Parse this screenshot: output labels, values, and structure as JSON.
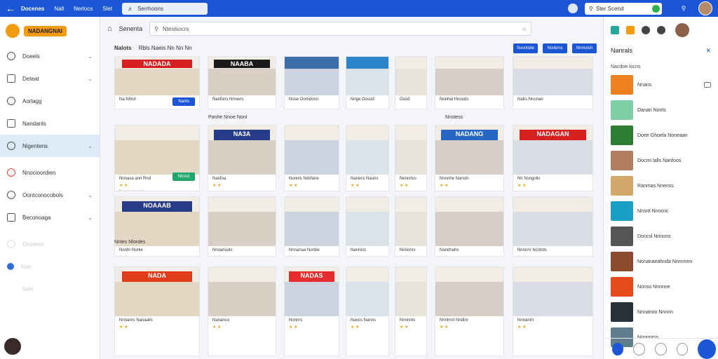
{
  "topbar": {
    "tabs": [
      "Docenes",
      "Nall",
      "Nerlocs",
      "Slet"
    ],
    "url_text": "Serrhoons",
    "search_text": "Ster Scend"
  },
  "sidebar": {
    "brand": "NADANGNAI",
    "items": [
      {
        "label": "Doeels",
        "chev": true
      },
      {
        "label": "Deteat",
        "chev": true
      },
      {
        "label": "Aorlagg",
        "chev": false
      },
      {
        "label": "Nandanls",
        "chev": false
      },
      {
        "label": "Nigentens",
        "chev": true
      },
      {
        "label": "Nnocioordien",
        "chev": false
      },
      {
        "label": "Oontconocobols",
        "chev": true
      },
      {
        "label": "Beconoaga",
        "chev": true
      },
      {
        "label": "Ossieels",
        "chev": false
      },
      {
        "label": "Nan",
        "chev": false
      },
      {
        "label": "Ilam",
        "chev": false
      }
    ]
  },
  "main": {
    "breadcrumb": "Senenta",
    "search_placeholder": "Nteslsocrs",
    "grid_title": "Nalots",
    "grid_sub": "Rbls  Naeis  Nn  Nn Nn",
    "buttons": [
      "Soonlsbe",
      "Nsnkrns",
      "Nnmslsh"
    ],
    "sections": [
      "Nnstess",
      "Nntes Nlordes"
    ],
    "cards_row1": [
      {
        "caption": "Na Nhnd",
        "sign": "NADADA",
        "action": "Nants"
      },
      {
        "caption": "Nanfons Nnnwrs",
        "sign": "NAABA"
      },
      {
        "caption": "Nose Oorndons",
        "sign": ""
      },
      {
        "caption": "Nnge Oosod",
        "sign": ""
      },
      {
        "caption": "Oosd",
        "sign": ""
      },
      {
        "caption": "Nonhal Hnouds",
        "sign": ""
      },
      {
        "caption": "Nalrs Nnunan",
        "sign": ""
      }
    ],
    "cards_row2_header": "Panhe  Nnoe Nonl",
    "cards_row2": [
      {
        "caption": "Nnnasa ann Rnd",
        "sign": "",
        "action": "Nlcicd",
        "sub": "Nnonsnoocm"
      },
      {
        "caption": "Nanfoa",
        "sign": "NA3A"
      },
      {
        "caption": "Nonnls Ndsfane",
        "sign": ""
      },
      {
        "caption": "Nanecs Nauns",
        "sign": ""
      },
      {
        "caption": "Nennrtcs",
        "sign": ""
      },
      {
        "caption": "Nnnnhe Nanstn",
        "sign": "NADANG"
      },
      {
        "caption": "Nn Nsngnlls",
        "sign": "NADAGAN"
      }
    ],
    "cards_row3": [
      {
        "caption": "Nonhr Nonle",
        "sign": "NOAAAB"
      },
      {
        "caption": "Nnoansols",
        "sign": ""
      },
      {
        "caption": "Nnnanaa Nonbe",
        "sign": ""
      },
      {
        "caption": "Nanrocc",
        "sign": ""
      },
      {
        "caption": "Nnnonrs",
        "sign": ""
      },
      {
        "caption": "Nandnahs",
        "sign": ""
      },
      {
        "caption": "Nnnnnr Ncnhds",
        "sign": ""
      }
    ],
    "cards_row4": [
      {
        "caption": "Nnnanrs Nanaalls",
        "sign": "NADA"
      },
      {
        "caption": "Nananco",
        "sign": ""
      },
      {
        "caption": "Nonnrs",
        "sign": "NADAS"
      },
      {
        "caption": "Nancs Nanns",
        "sign": ""
      },
      {
        "caption": "Nnnnnts",
        "sign": ""
      },
      {
        "caption": "Nnnhnrt Nndinr",
        "sign": ""
      },
      {
        "caption": "Nnnanrn",
        "sign": ""
      }
    ]
  },
  "right": {
    "title": "Nanrals",
    "subtitle": "Nacdoe locns",
    "items": [
      {
        "label": "Nnans",
        "color": "#f08020"
      },
      {
        "label": "Danan Nonts",
        "color": "#7fd0a6"
      },
      {
        "label": "Doee Ghoela Noneaan",
        "color": "#2e7d32"
      },
      {
        "label": "Docnn lalls Nanfoos",
        "color": "#b07d5e"
      },
      {
        "label": "Ranmas Nnenss",
        "color": "#d4a76a"
      },
      {
        "label": "Nnsrd Nnncnc",
        "color": "#1aa0c7"
      },
      {
        "label": "Doncsl Nnnons",
        "color": "#555"
      },
      {
        "label": "Nonanaeahnda Nnnnnnn",
        "color": "#8c4a2f"
      },
      {
        "label": "Nonso Nnnnne",
        "color": "#e64a19"
      },
      {
        "label": "Nnnanoo Nnnnn",
        "color": "#263238"
      },
      {
        "label": "Nnnnnrss",
        "color": "#607d8b"
      }
    ]
  }
}
